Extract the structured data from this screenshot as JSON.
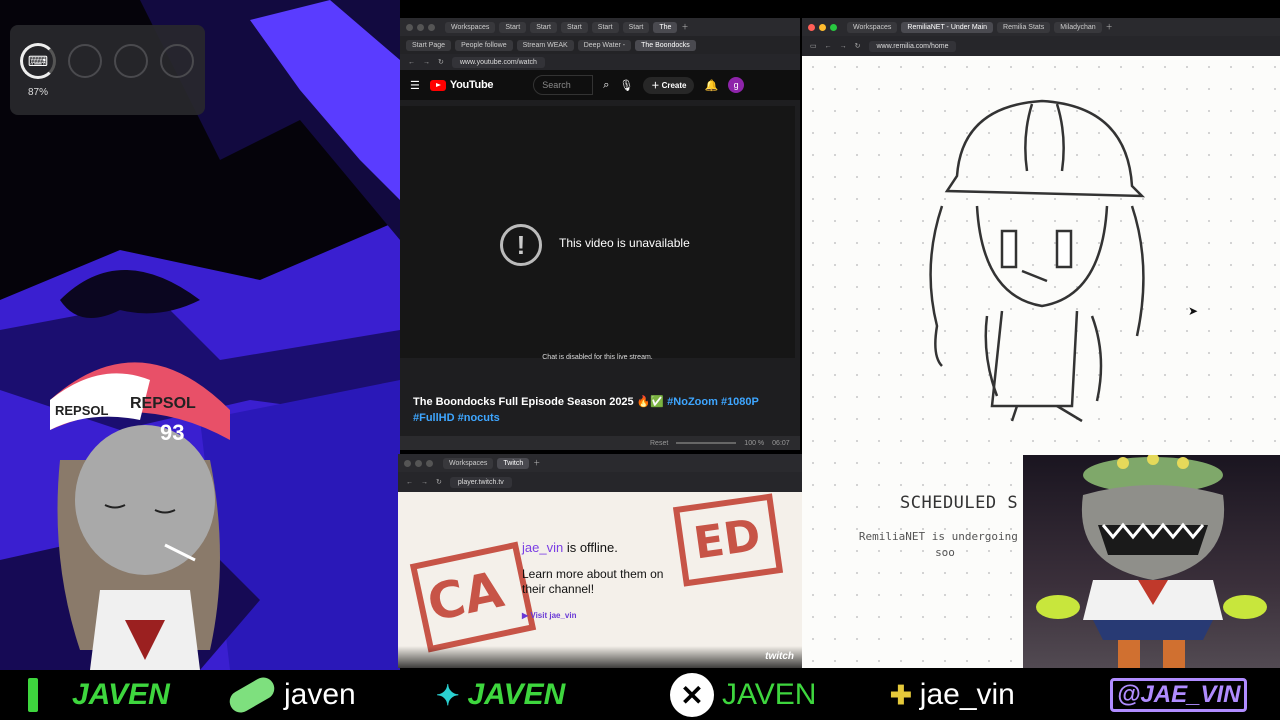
{
  "overlay": {
    "percent": "87%"
  },
  "youtube_window": {
    "tabs": [
      "Workspaces",
      "Start",
      "Start",
      "Start",
      "Start",
      "Start",
      "The"
    ],
    "bookmarks": [
      "Start Page",
      "People followe",
      "Stream WEAK",
      "Deep Water -",
      "The Boondocks"
    ],
    "url": "www.youtube.com/watch",
    "search_placeholder": "Search",
    "create_label": "Create",
    "avatar_letter": "g",
    "logo_text": "YouTube",
    "unavailable_text": "This video is unavailable",
    "chat_disabled": "Chat is disabled for this live stream.",
    "title_plain": "The Boondocks Full Episode Season 2025 🔥✅ ",
    "title_tags_1": "#NoZoom #1080P",
    "title_tags_2": "#FullHD #nocuts",
    "controls": {
      "reset": "Reset",
      "zoom": "100 %",
      "time": "06:07"
    }
  },
  "twitch_window": {
    "tabs": [
      "Workspaces",
      "Twitch"
    ],
    "url": "player.twitch.tv",
    "channel": "jae_vin",
    "offline_suffix": " is offline.",
    "learn_more": "Learn more about them on their channel!",
    "visit_label": "▶ Visit jae_vin",
    "stamp_left": "CA",
    "stamp_right": "ED",
    "logo": "twitch"
  },
  "remilia_window": {
    "tabs": [
      "Workspaces",
      "RemiliaNET - Under Main",
      "Remilia Stats",
      "Miladychan"
    ],
    "url": "www.remilia.com/home",
    "scheduled": "SCHEDULED S",
    "subtext_line1": "RemiliaNET is undergoing s",
    "subtext_line2": "soo"
  },
  "ticker": [
    {
      "name": "JAVEN",
      "color": "#3ed63e",
      "icon": "cursor-bar-icon"
    },
    {
      "name": "javen",
      "color": "#ffffff",
      "icon": "pill-icon"
    },
    {
      "name": "JAVEN",
      "color": "#3ed63e",
      "icon": "splash-icon"
    },
    {
      "name": "JAVEN",
      "color": "#3ed63e",
      "icon": "xbox-icon"
    },
    {
      "name": "jae_vin",
      "color": "#ffffff",
      "icon": "playstation-icon"
    },
    {
      "name": "@JAE_VIN",
      "color": "#b08cff",
      "icon": "twitch-icon"
    }
  ],
  "colors": {
    "accent_green": "#3ed63e",
    "youtube_red": "#ff0000",
    "twitch_purple": "#7b3fe4"
  }
}
